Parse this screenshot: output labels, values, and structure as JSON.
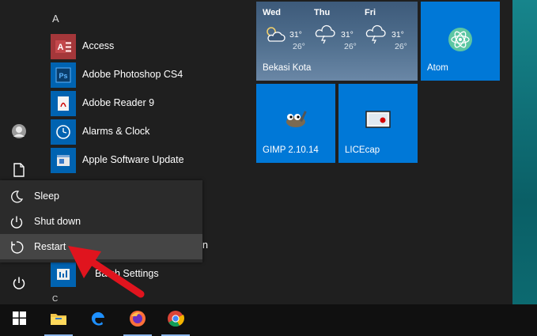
{
  "start_menu": {
    "section_letter_a": "A",
    "section_letter_c": "C",
    "apps": [
      {
        "label": "Access",
        "icon": "access-icon",
        "color": "#a4373a"
      },
      {
        "label": "Adobe Photoshop CS4",
        "icon": "photoshop-icon",
        "color": "#0063b1"
      },
      {
        "label": "Adobe Reader 9",
        "icon": "reader-icon",
        "color": "#0063b1"
      },
      {
        "label": "Alarms & Clock",
        "icon": "alarm-clock-icon",
        "color": "#0063b1"
      },
      {
        "label": "Apple Software Update",
        "icon": "apple-update-icon",
        "color": "#0063b1"
      },
      {
        "label": "n",
        "icon": "hidden-app-icon",
        "color": "#0063b1"
      },
      {
        "label": "Batch Settings",
        "icon": "batch-settings-icon",
        "color": "#0063b1"
      }
    ]
  },
  "tiles": {
    "weather": {
      "location": "Bekasi Kota",
      "days": [
        {
          "name": "Wed",
          "high": "31°",
          "low": "26°"
        },
        {
          "name": "Thu",
          "high": "31°",
          "low": "26°"
        },
        {
          "name": "Fri",
          "high": "31°",
          "low": "26°"
        }
      ]
    },
    "atom": {
      "label": "Atom"
    },
    "gimp": {
      "label": "GIMP 2.10.14"
    },
    "licecap": {
      "label": "LICEcap"
    }
  },
  "power_menu": {
    "sleep": "Sleep",
    "shutdown": "Shut down",
    "restart": "Restart"
  },
  "colors": {
    "tile_blue": "#0078d7",
    "arrow_red": "#e0141e",
    "menu_bg": "#1f1f1f",
    "power_bg": "#2b2b2b",
    "highlight": "#454545"
  }
}
